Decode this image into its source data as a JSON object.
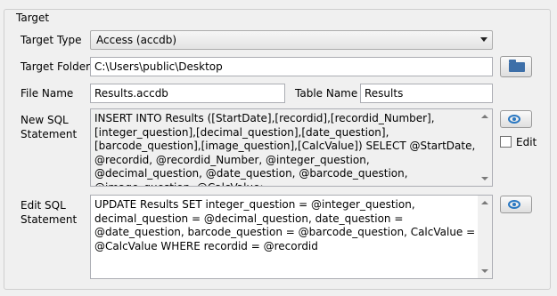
{
  "group": {
    "title": "Target"
  },
  "target_type": {
    "label": "Target Type",
    "value": "Access (accdb)"
  },
  "target_folder": {
    "label": "Target Folder",
    "value": "C:\\Users\\public\\Desktop"
  },
  "file_name": {
    "label": "File Name",
    "value": "Results.accdb"
  },
  "table_name": {
    "label": "Table Name",
    "value": "Results"
  },
  "new_sql": {
    "label_line1": "New SQL",
    "label_line2": "Statement",
    "value": "INSERT INTO Results ([StartDate],[recordid],[recordid_Number],[integer_question],[decimal_question],[date_question],[barcode_question],[image_question],[CalcValue]) SELECT @StartDate, @recordid, @recordid_Number, @integer_question, @decimal_question, @date_question, @barcode_question, @image_question, @CalcValue;"
  },
  "edit_checkbox": {
    "label": "Edit",
    "checked": false
  },
  "edit_sql": {
    "label_line1": "Edit SQL",
    "label_line2": "Statement",
    "value": "UPDATE Results SET integer_question = @integer_question, decimal_question = @decimal_question, date_question = @date_question, barcode_question = @barcode_question, CalcValue = @CalcValue WHERE recordid = @recordid"
  },
  "icons": {
    "view": "eye-icon",
    "browse": "folder-icon"
  },
  "colors": {
    "accent": "#2a78c2",
    "folder": "#3d6fa8"
  }
}
